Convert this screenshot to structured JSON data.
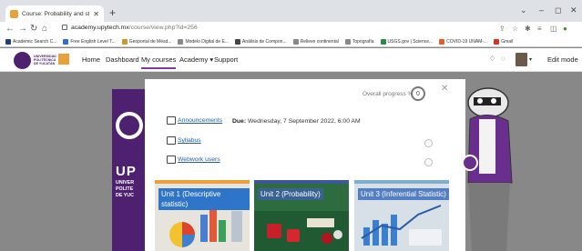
{
  "browser": {
    "tab_title": "Course: Probability and statistic",
    "tab_close": "✕",
    "new_tab": "+",
    "window_controls": {
      "minimize": "–",
      "maximize": "◻",
      "close": "✕",
      "chevron": "⌄"
    },
    "url_host": "academy.upytech.mx",
    "url_path": "/course/view.php?id=256",
    "bookmarks": [
      {
        "label": "Academic Search C...",
        "color": "#1f3f7a"
      },
      {
        "label": "Free English Level T...",
        "color": "#2f6fd1"
      },
      {
        "label": "Geoportal de Mésd...",
        "color": "#c79a2a"
      },
      {
        "label": "Modelo Digital de E...",
        "color": "#888888"
      },
      {
        "label": "Análisis de Compon...",
        "color": "#444444"
      },
      {
        "label": "Relieve continental",
        "color": "#888888"
      },
      {
        "label": "Topografía",
        "color": "#888888"
      },
      {
        "label": "USGS.gov | Science...",
        "color": "#2a8a4a"
      },
      {
        "label": "COVID-19 UNAM-...",
        "color": "#e0602a"
      },
      {
        "label": "Gmail",
        "color": "#d93025"
      }
    ]
  },
  "navbar": {
    "home": "Home",
    "dashboard": "Dashboard",
    "my_courses": "My courses",
    "academy": "Academy ▾",
    "support": "Support",
    "edit_mode": "Edit mode",
    "logo_text": "UNIVERSIDAD POLITÉCNICA DE YUCATÁN"
  },
  "course": {
    "overall_progress_label": "Overall progress %",
    "overall_progress_value": "0",
    "close": "✕",
    "activities": [
      {
        "name": "Announcements"
      },
      {
        "name": "Syllabus"
      },
      {
        "name": "Webwork users"
      }
    ],
    "due_label": "Due:",
    "due_value": "Wednesday, 7 September 2022, 6:00 AM",
    "units": [
      {
        "title": "Unit 1 (Descriptive statistic)"
      },
      {
        "title": "Unit 2 (Probability)"
      },
      {
        "title": "Unit 3 (Inferential Statistic)"
      }
    ],
    "school_logo_lines": [
      "UP",
      "UNIVER",
      "POLITE",
      "DE YUC"
    ]
  },
  "colors": {
    "brand_purple": "#4d2170",
    "accent_orange": "#e9a23b",
    "link_blue": "#1c5fa8"
  }
}
